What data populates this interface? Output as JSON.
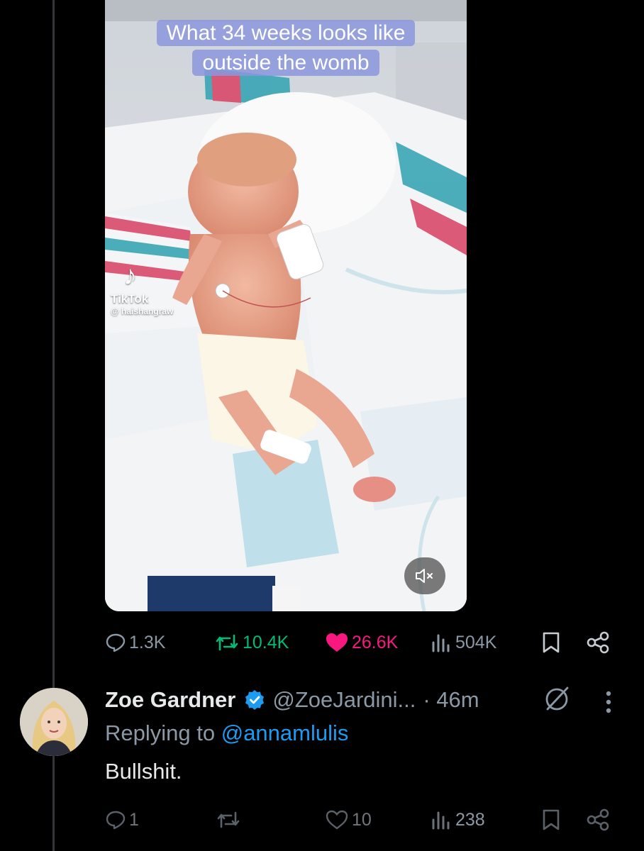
{
  "tweet": {
    "media": {
      "caption_lines": [
        "What 34 weeks looks like",
        "outside the womb"
      ],
      "watermark_brand": "TikTok",
      "watermark_handle": "@ haishangraw",
      "mute_icon": "speaker-muted-icon"
    },
    "stats": {
      "replies": "1.3K",
      "reposts": "10.4K",
      "likes": "26.6K",
      "views": "504K"
    },
    "colors": {
      "repost": "#00ba7c",
      "like": "#f91880",
      "muted_text": "#8b98a5"
    }
  },
  "reply": {
    "display_name": "Zoe Gardner",
    "handle": "@ZoeJardini...",
    "time": "· 46m",
    "replying_prefix": "Replying to",
    "replying_to": "@annamlulis",
    "text": "Bullshit.",
    "stats": {
      "replies": "1",
      "likes": "10",
      "views": "238"
    },
    "colors": {
      "verified": "#1d9bf0",
      "mention": "#1d9bf0"
    }
  }
}
